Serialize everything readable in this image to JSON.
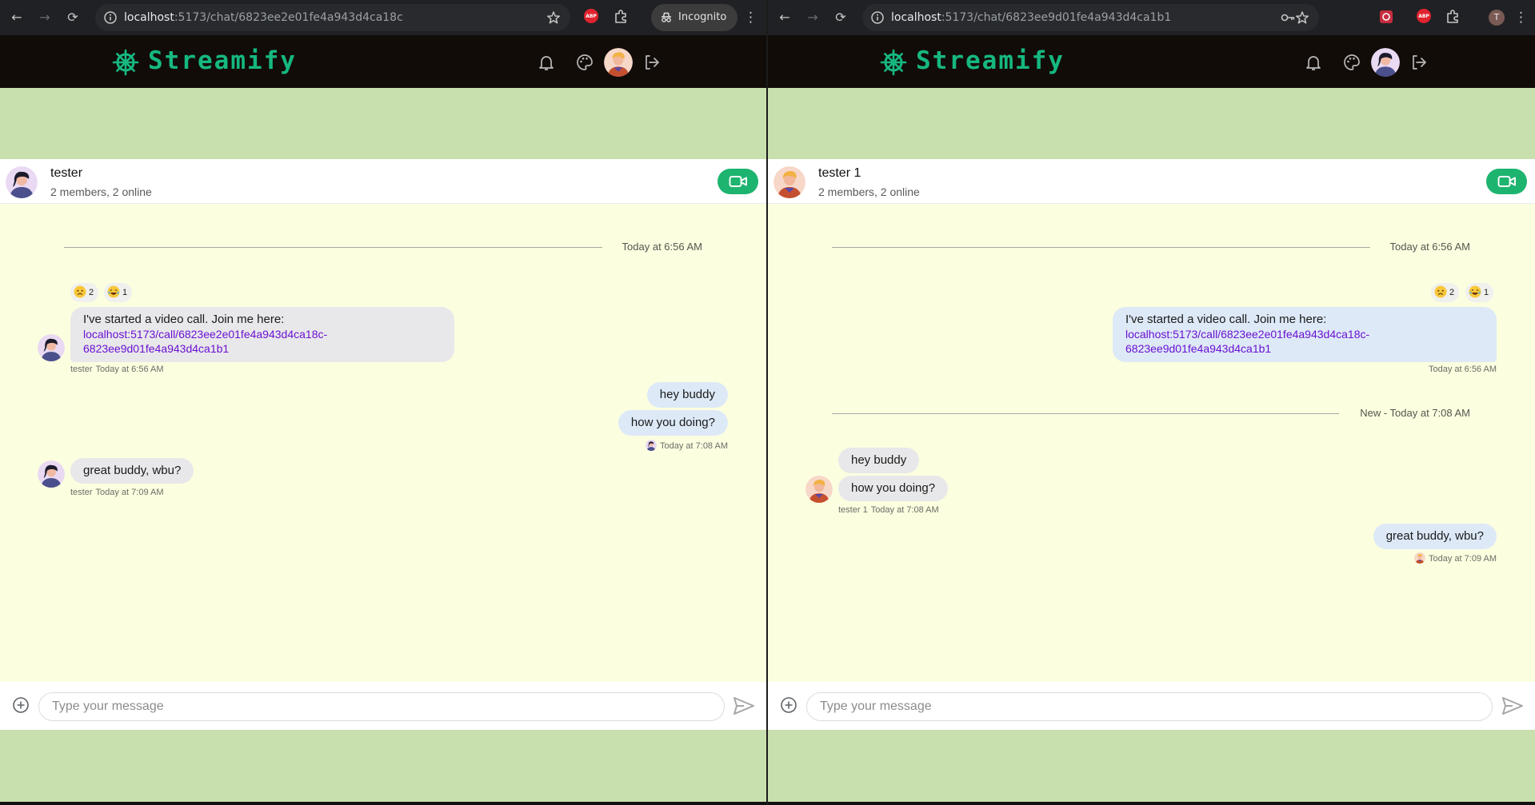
{
  "left": {
    "browser": {
      "url_host": "localhost",
      "url_path": ":5173/chat/6823ee2e01fe4a943d4ca18c",
      "incognito_label": "Incognito"
    },
    "app": {
      "brand": "Streamify"
    },
    "chat": {
      "name": "tester",
      "members": "2 members, 2 online",
      "date_separator": "Today at 6:56 AM",
      "call_message": {
        "reactions": [
          {
            "emoji": "worried-face",
            "count": "2"
          },
          {
            "emoji": "laughing-face",
            "count": "1"
          }
        ],
        "text": "I've started a video call. Join me here:",
        "link": "localhost:5173/call/6823ee2e01fe4a943d4ca18c-6823ee9d01fe4a943d4ca1b1",
        "link_line1": "localhost:5173/call/6823ee2e01fe4a943d4ca18c-",
        "link_line2": "6823ee9d01fe4a943d4ca1b1",
        "sender": "tester",
        "time": "Today at 6:56 AM"
      },
      "outgoing": {
        "messages": [
          "hey buddy",
          "how you doing?"
        ],
        "time": "Today at 7:08 AM"
      },
      "reply": {
        "text": "great buddy, wbu?",
        "sender": "tester",
        "time": "Today at 7:09 AM"
      },
      "composer_placeholder": "Type your message"
    }
  },
  "right": {
    "browser": {
      "url_host": "localhost",
      "url_path": ":5173/chat/6823ee9d01fe4a943d4ca1b1",
      "profile_initial": "T"
    },
    "app": {
      "brand": "Streamify"
    },
    "chat": {
      "name": "tester 1",
      "members": "2 members, 2 online",
      "date_separator": "Today at 6:56 AM",
      "call_message": {
        "reactions": [
          {
            "emoji": "worried-face",
            "count": "2"
          },
          {
            "emoji": "laughing-face",
            "count": "1"
          }
        ],
        "text": "I've started a video call. Join me here:",
        "link_line1": "localhost:5173/call/6823ee2e01fe4a943d4ca18c-",
        "link_line2": "6823ee9d01fe4a943d4ca1b1",
        "time": "Today at 6:56 AM"
      },
      "new_separator": "New - Today at 7:08 AM",
      "incoming": {
        "messages": [
          "hey buddy",
          "how you doing?"
        ],
        "sender": "tester 1",
        "time": "Today at 7:08 AM"
      },
      "outgoing": {
        "text": "great buddy, wbu?",
        "time": "Today at 7:09 AM"
      },
      "composer_placeholder": "Type your message"
    }
  },
  "colors": {
    "accent": "#16b880",
    "page_bg": "#c8dfae",
    "chat_bg": "#fcfee0",
    "video_btn": "#1db46f",
    "link": "#6a11d2",
    "header_bg": "#120c09"
  }
}
